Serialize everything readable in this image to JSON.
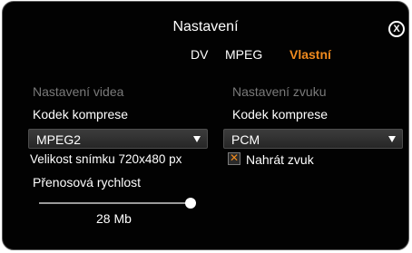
{
  "dialog": {
    "title": "Nastavení",
    "close_icon": "close-circle-icon",
    "close_glyph": "X"
  },
  "tabs": [
    {
      "label": "DV",
      "active": false
    },
    {
      "label": "MPEG",
      "active": false
    },
    {
      "label": "Vlastní",
      "active": true
    }
  ],
  "video": {
    "section_title": "Nastavení videa",
    "codec_label": "Kodek komprese",
    "codec_value": "MPEG2",
    "frame_size": "Velikost snímku 720x480 px",
    "bitrate_label": "Přenosová rychlost",
    "bitrate_value": "28 Mb",
    "bitrate_level": 1.0
  },
  "audio": {
    "section_title": "Nastavení zvuku",
    "codec_label": "Kodek komprese",
    "codec_value": "PCM",
    "record_audio_label": "Nahrát zvuk",
    "record_audio_checked": true,
    "checkbox_mark": "✕"
  },
  "colors": {
    "background": "#020202",
    "accent": "#f08a1e",
    "section_title": "#7a7a7a"
  }
}
